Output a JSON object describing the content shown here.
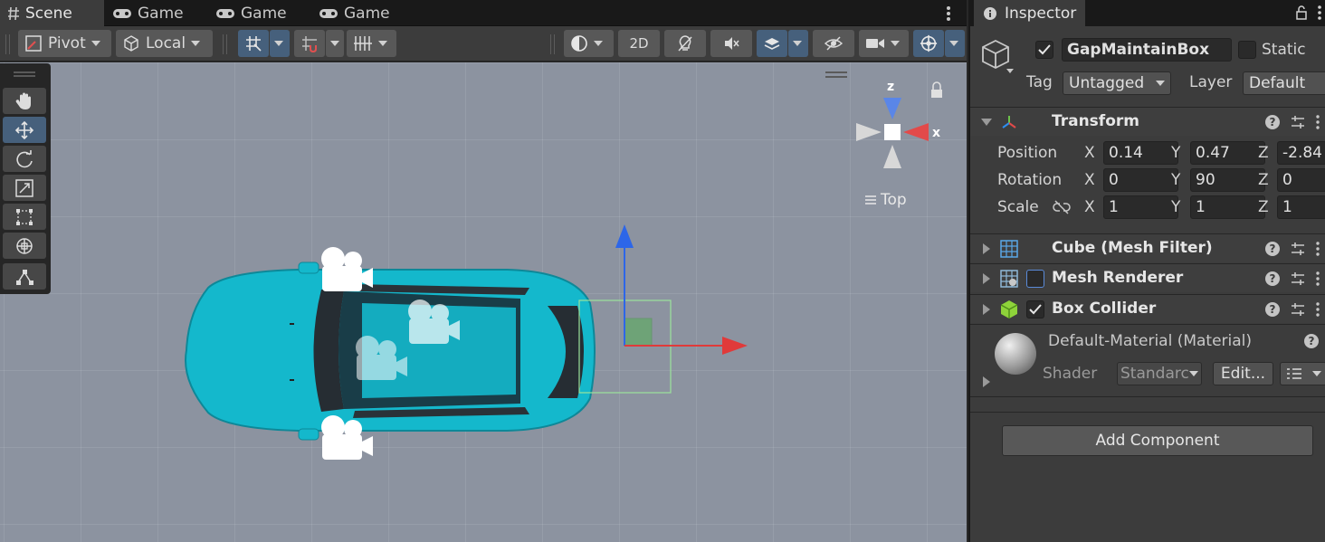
{
  "scene_tabs": [
    {
      "label": "Scene",
      "icon": "grid-hash-icon",
      "active": true
    },
    {
      "label": "Game",
      "icon": "gamepad-icon"
    },
    {
      "label": "Game",
      "icon": "gamepad-icon"
    },
    {
      "label": "Game",
      "icon": "gamepad-icon"
    }
  ],
  "toolbar": {
    "pivot_label": "Pivot",
    "local_label": "Local",
    "mode_2d_label": "2D"
  },
  "tools": [
    "hand-tool",
    "move-tool",
    "rotate-tool",
    "scale-tool",
    "rect-tool",
    "transform-tool",
    "custom-tool"
  ],
  "gizmo": {
    "z_label": "z",
    "x_label": "x",
    "view_label": "Top"
  },
  "inspector": {
    "tab_label": "Inspector",
    "object": {
      "active": true,
      "name": "GapMaintainBox",
      "static_label": "Static",
      "tag_label": "Tag",
      "tag_value": "Untagged",
      "layer_label": "Layer",
      "layer_value": "Default"
    },
    "transform": {
      "title": "Transform",
      "position_label": "Position",
      "rotation_label": "Rotation",
      "scale_label": "Scale",
      "axis_x": "X",
      "axis_y": "Y",
      "axis_z": "Z",
      "position": {
        "x": "0.14",
        "y": "0.47",
        "z": "-2.84"
      },
      "rotation": {
        "x": "0",
        "y": "90",
        "z": "0"
      },
      "scale": {
        "x": "1",
        "y": "1",
        "z": "1"
      }
    },
    "components": [
      {
        "title": "Cube (Mesh Filter)"
      },
      {
        "title": "Mesh Renderer",
        "enabled": false
      },
      {
        "title": "Box Collider",
        "enabled": true
      }
    ],
    "material": {
      "title": "Default-Material (Material)",
      "shader_label": "Shader",
      "shader_value": "Standarc",
      "edit_label": "Edit..."
    },
    "add_component_label": "Add Component"
  },
  "colors": {
    "car_body": "#14b8cc",
    "axis_x": "#e03a3a",
    "axis_y": "#2d66e8",
    "selection_accent": "#46607c",
    "viewport_bg": "#8c93a0"
  }
}
